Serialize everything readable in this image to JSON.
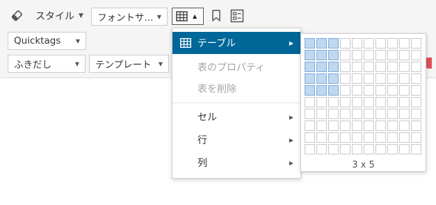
{
  "toolbar": {
    "eraser_icon": "eraser-icon",
    "style_label": "スタイル",
    "font_label": "フォントサ...",
    "table_icon": "table-icon",
    "bookmark_icon": "bookmark-icon",
    "template_icon": "layout-icon"
  },
  "row2": {
    "quicktags_label": "Quicktags"
  },
  "row3": {
    "fukidashi_label": "ふきだし",
    "template_label": "テンプレート"
  },
  "table_menu": {
    "items": [
      {
        "label": "テーブル",
        "state": "active",
        "has_submenu": true
      },
      {
        "label": "表のプロパティ",
        "state": "disabled",
        "has_submenu": false
      },
      {
        "label": "表を削除",
        "state": "disabled",
        "has_submenu": false
      },
      {
        "label": "セル",
        "state": "normal",
        "has_submenu": true
      },
      {
        "label": "行",
        "state": "normal",
        "has_submenu": true
      },
      {
        "label": "列",
        "state": "normal",
        "has_submenu": true
      }
    ]
  },
  "grid_picker": {
    "cols": 10,
    "rows": 10,
    "selected_cols": 3,
    "selected_rows": 5,
    "size_label": "3 x 5"
  },
  "colors": {
    "accent": "#006799",
    "selection": "#bfd7f1",
    "warning": "#e0505a"
  }
}
